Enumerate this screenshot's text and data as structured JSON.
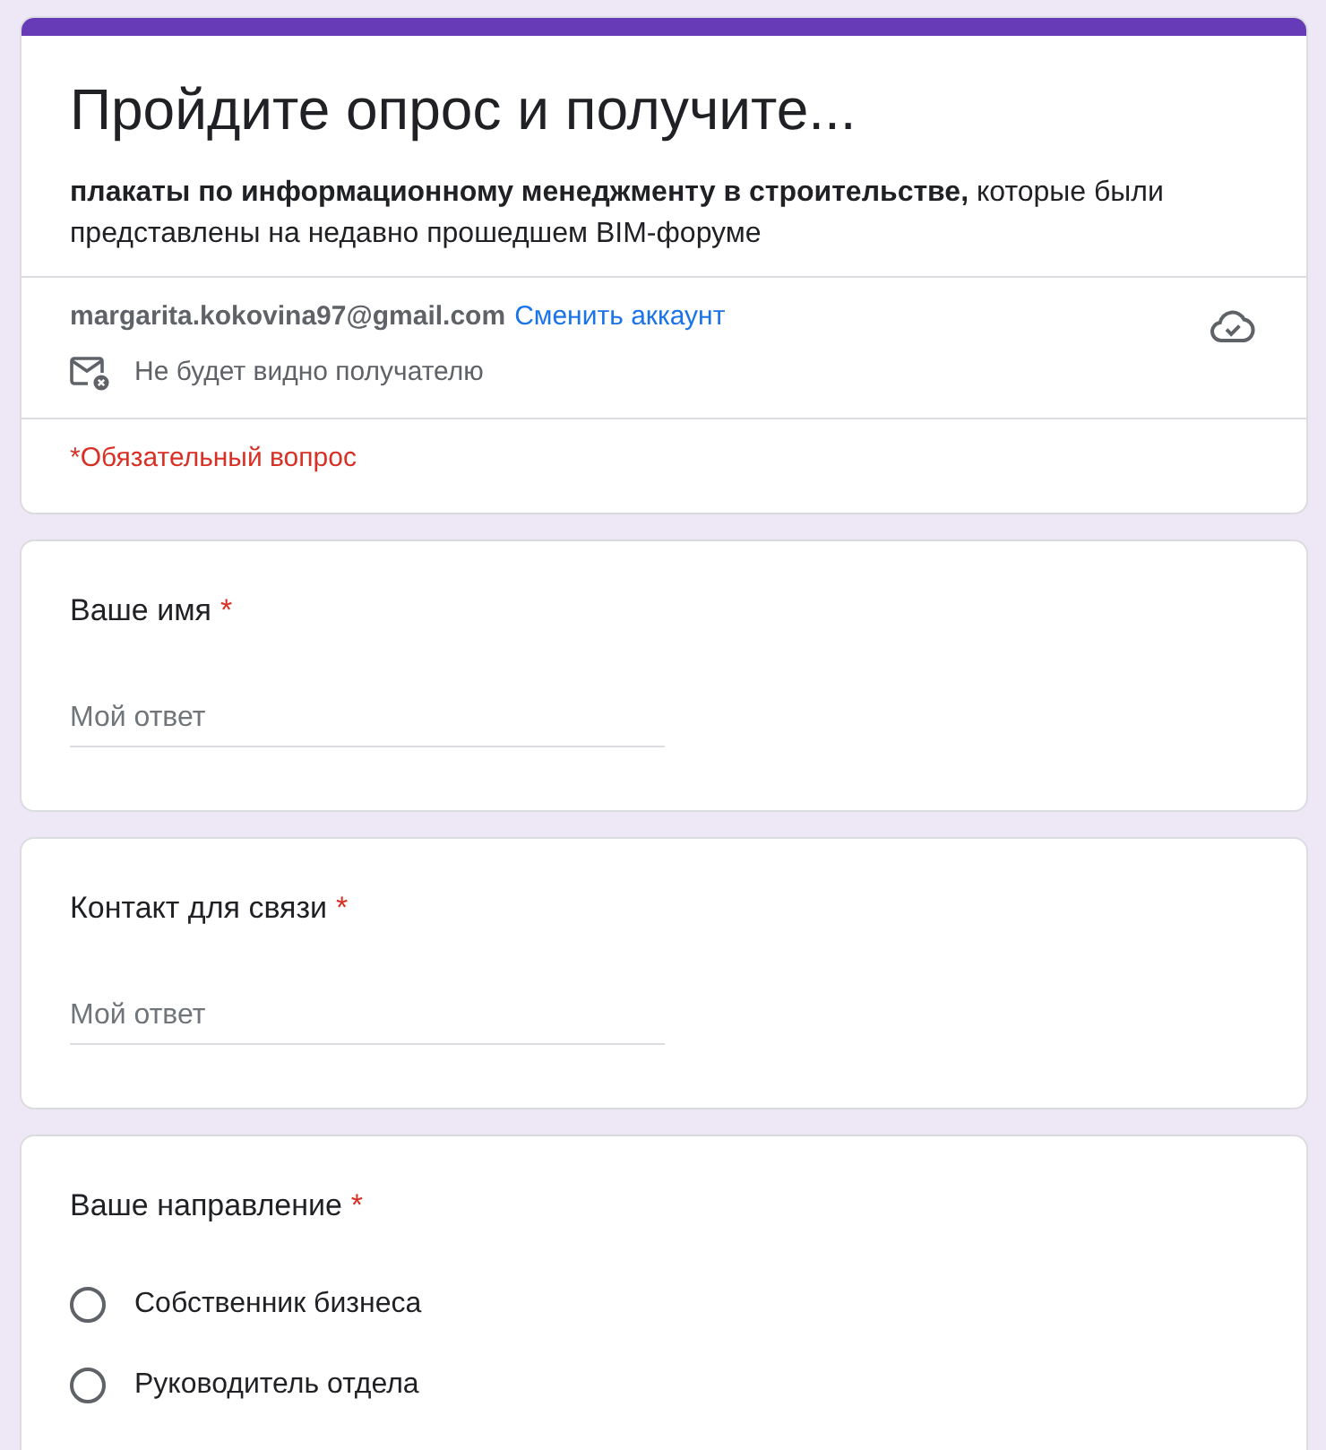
{
  "header": {
    "title": "Пройдите опрос и получите...",
    "description": "**плакаты по информационному менеджменту в строительстве,** которые были представлены на недавно прошедшем BIM-форуме",
    "account": {
      "email": "margarita.kokovina97@gmail.com",
      "switch_link": "Сменить аккаунт",
      "privacy_note": "Не будет видно получателю"
    },
    "required_note": "*Обязательный вопрос"
  },
  "questions": [
    {
      "kind": "text",
      "label": "Ваше имя",
      "required_mark": "*",
      "placeholder": "Мой ответ"
    },
    {
      "kind": "text",
      "label": "Контакт для связи",
      "required_mark": "*",
      "placeholder": "Мой ответ"
    },
    {
      "kind": "radio",
      "label": "Ваше направление",
      "required_mark": "*",
      "options": [
        {
          "label": "Собственник бизнеса",
          "selected": false
        },
        {
          "label": "Руководитель отдела",
          "selected": false
        }
      ]
    }
  ]
}
